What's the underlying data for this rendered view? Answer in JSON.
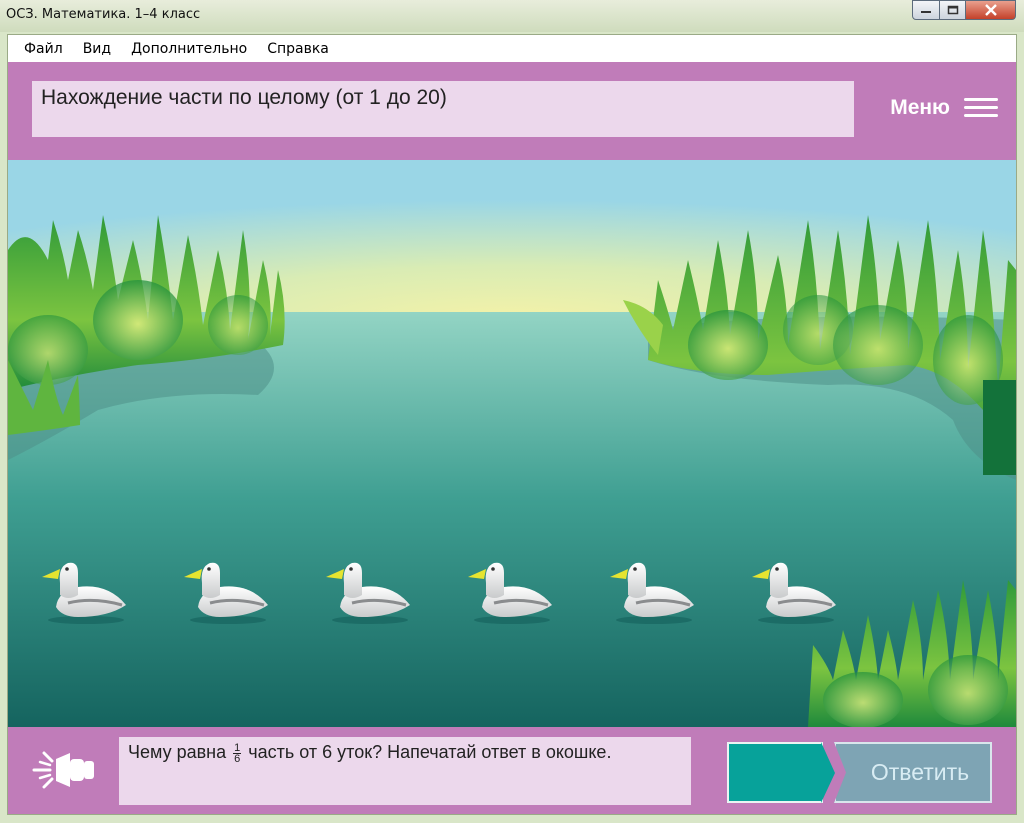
{
  "window": {
    "title": "ОСЗ. Математика. 1–4 класс"
  },
  "menubar": {
    "items": [
      "Файл",
      "Вид",
      "Дополнительно",
      "Справка"
    ]
  },
  "header": {
    "task_title": "Нахождение части по целому (от 1 до 20)",
    "menu_label": "Меню"
  },
  "scene": {
    "duck_count": 6
  },
  "footer": {
    "question_before": "Чему равна",
    "fraction_numerator": "1",
    "fraction_denominator": "6",
    "question_after": "часть от 6 уток? Напечатай ответ в окошке.",
    "answer_value": "",
    "submit_label": "Ответить"
  },
  "colors": {
    "accent_purple": "#c07cb9",
    "panel_pink": "#ecd8ec",
    "answer_teal": "#07a29a",
    "submit_gray_blue": "#7ea4b4"
  },
  "icons": {
    "speaker": "speaker-icon",
    "menu": "hamburger-icon"
  }
}
